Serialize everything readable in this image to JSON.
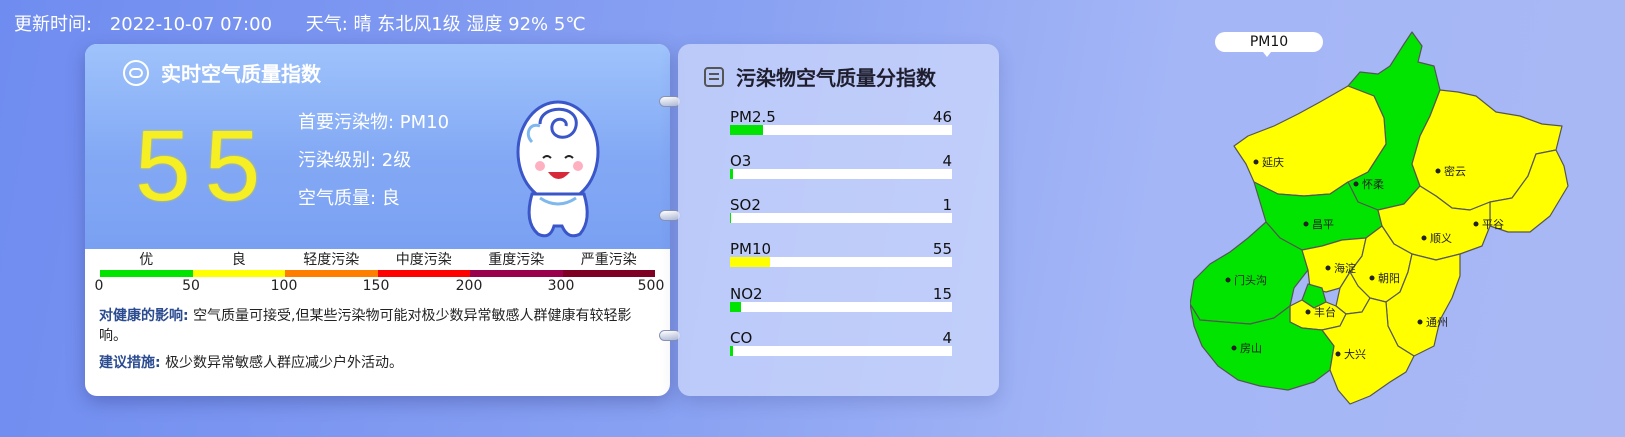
{
  "header": {
    "update_label": "更新时间:",
    "update_time": "2022-10-07 07:00",
    "weather": "天气: 晴 东北风1级 湿度 92% 5℃"
  },
  "aqi": {
    "title": "实时空气质量指数",
    "value": "55",
    "primary_pollutant": "首要污染物: PM10",
    "level": "污染级别: 2级",
    "quality": "空气质量: 良",
    "value_color": "#f6ef23"
  },
  "scale": {
    "levels": [
      {
        "label": "优",
        "color": "#00e400"
      },
      {
        "label": "良",
        "color": "#ffff00"
      },
      {
        "label": "轻度污染",
        "color": "#ff7e00"
      },
      {
        "label": "中度污染",
        "color": "#ff0000"
      },
      {
        "label": "重度污染",
        "color": "#99004c"
      },
      {
        "label": "严重污染",
        "color": "#7e0023"
      }
    ],
    "ticks": [
      "0",
      "50",
      "100",
      "150",
      "200",
      "300",
      "500"
    ]
  },
  "health": {
    "label": "对健康的影响:",
    "text": "空气质量可接受,但某些污染物可能对极少数异常敏感人群健康有较轻影响。"
  },
  "advice": {
    "label": "建议措施:",
    "text": "极少数异常敏感人群应减少户外活动。"
  },
  "pollutants": {
    "title": "污染物空气质量分指数",
    "items": [
      {
        "name": "PM2.5",
        "value": "46",
        "fraction": 0.15,
        "color": "#00e400"
      },
      {
        "name": "O3",
        "value": "4",
        "fraction": 0.013,
        "color": "#00e400"
      },
      {
        "name": "SO2",
        "value": "1",
        "fraction": 0.005,
        "color": "#00e400"
      },
      {
        "name": "PM10",
        "value": "55",
        "fraction": 0.18,
        "color": "#ffff00"
      },
      {
        "name": "NO2",
        "value": "15",
        "fraction": 0.05,
        "color": "#00e400"
      },
      {
        "name": "CO",
        "value": "4",
        "fraction": 0.013,
        "color": "#00e400"
      }
    ]
  },
  "map": {
    "label": "PM10",
    "districts": {
      "yanqing": "延庆",
      "huairou": "怀柔",
      "miyun": "密云",
      "changping": "昌平",
      "pinggu": "平谷",
      "shunyi": "顺义",
      "mentougou": "门头沟",
      "haidian": "海淀",
      "chaoyang": "朝阳",
      "fengtai": "丰台",
      "fangshan": "房山",
      "tongzhou": "通州",
      "daxing": "大兴"
    },
    "colors": {
      "good": "#00e400",
      "moderate": "#ffff00"
    }
  }
}
